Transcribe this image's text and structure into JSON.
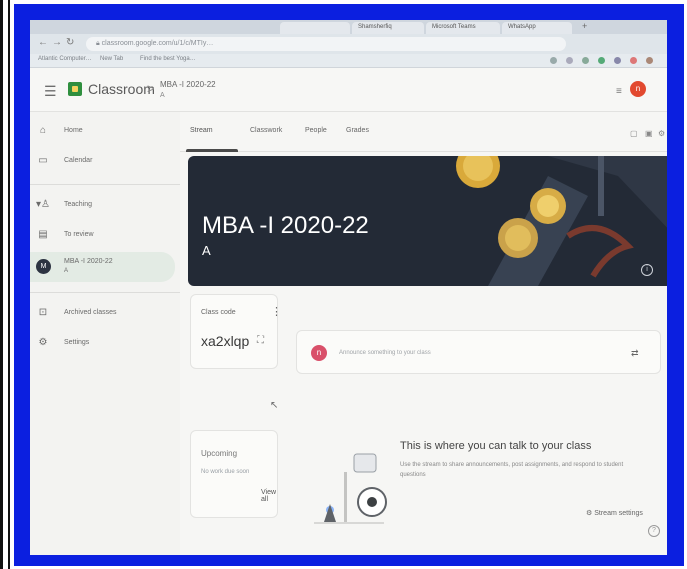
{
  "browser": {
    "tabs": [
      "",
      "Shamsherfiq",
      "Microsoft Teams",
      "WhatsApp"
    ],
    "url": "classroom.google.com/u/1/c/MTIy…",
    "bookmarks": [
      "Atlantic Computer…",
      "New Tab",
      "Find the best Yoga…"
    ]
  },
  "header": {
    "app_name": "Classroom",
    "separator": ">",
    "class_title": "MBA -I 2020-22",
    "class_section": "A",
    "grid_icon": "apps-grid-icon",
    "user_initial": "n"
  },
  "sidebar": {
    "items": [
      {
        "label": "Home",
        "icon": "home-icon"
      },
      {
        "label": "Calendar",
        "icon": "calendar-icon"
      },
      {
        "label": "Teaching",
        "icon": "people-icon"
      },
      {
        "label": "To review",
        "icon": "review-icon"
      },
      {
        "label": "MBA -I 2020-22",
        "sub": "A",
        "initial": "M"
      },
      {
        "label": "Archived classes",
        "icon": "archive-icon"
      },
      {
        "label": "Settings",
        "icon": "gear-icon"
      }
    ]
  },
  "main": {
    "tabs": [
      "Stream",
      "Classwork",
      "People",
      "Grades"
    ],
    "banner": {
      "title": "MBA -I 2020-22",
      "section": "A"
    },
    "class_code": {
      "label": "Class code",
      "value": "xa2xlqp"
    },
    "upcoming": {
      "label": "Upcoming",
      "none": "No work due soon",
      "view_all": "View all"
    },
    "announce": {
      "initial": "n",
      "placeholder": "Announce something to your class"
    },
    "empty_state": {
      "title": "This is where you can talk to your class",
      "desc": "Use the stream to share announcements, post assignments, and respond to student questions",
      "settings": "Stream settings"
    }
  },
  "colors": {
    "frame_border": "#0b1fe0",
    "banner": "#232a36",
    "accent_green": "#2f8f3e",
    "avatar_red": "#e2492f",
    "avatar_pink": "#d9506a"
  }
}
